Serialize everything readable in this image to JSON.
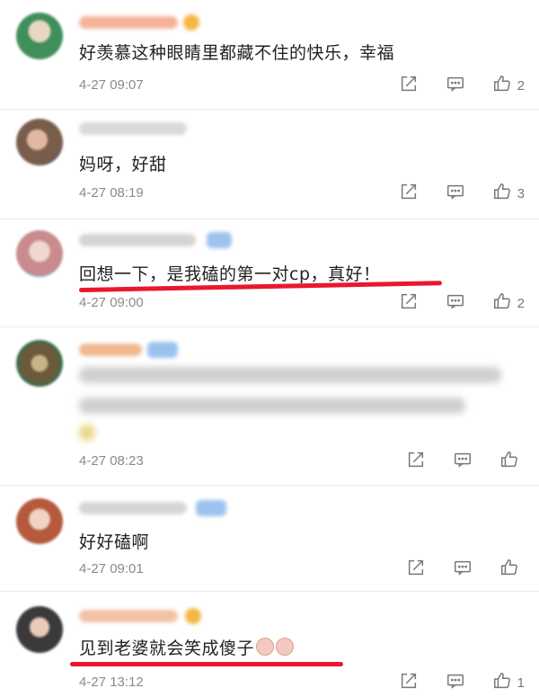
{
  "comments": [
    {
      "text": "好羡慕这种眼睛里都藏不住的快乐，幸福",
      "time": "4-27 09:07",
      "likes": "2",
      "avatar_color": "#3f8f5a",
      "name_color": "#f3b29a",
      "name_blurred": true,
      "underlined": false
    },
    {
      "text": "妈呀，好甜",
      "time": "4-27 08:19",
      "likes": "3",
      "avatar_color": "#7a5c4a",
      "name_color": "#d9d9d9",
      "name_blurred": true,
      "underlined": false
    },
    {
      "text": "回想一下，是我磕的第一对cp，真好！",
      "time": "4-27 09:00",
      "likes": "2",
      "avatar_color": "#c98b8e",
      "name_color": "#d4d4d4",
      "name_blurred": true,
      "underlined": true
    },
    {
      "text": "",
      "time": "4-27 08:23",
      "likes": "",
      "avatar_color": "#6b5a3a",
      "name_color": "#f0b990",
      "name_blurred": true,
      "text_blurred": true,
      "underlined": false
    },
    {
      "text": "好好磕啊",
      "time": "4-27 09:01",
      "likes": "",
      "avatar_color": "#b55a3c",
      "name_color": "#d6d6d6",
      "name_blurred": true,
      "underlined": false
    },
    {
      "text": "见到老婆就会笑成傻子",
      "time": "4-27 13:12",
      "likes": "1",
      "avatar_color": "#3a3a3a",
      "name_color": "#f3c1a6",
      "name_blurred": true,
      "underlined": true,
      "emoji": [
        "laugh-emoji",
        "laugh-emoji"
      ]
    }
  ],
  "icons": {
    "share": "share-icon",
    "comment": "comment-icon",
    "like": "thumbs-up-icon"
  },
  "colors": {
    "underline": "#e8182e",
    "time": "#8a8a8a",
    "divider": "#ececec"
  }
}
